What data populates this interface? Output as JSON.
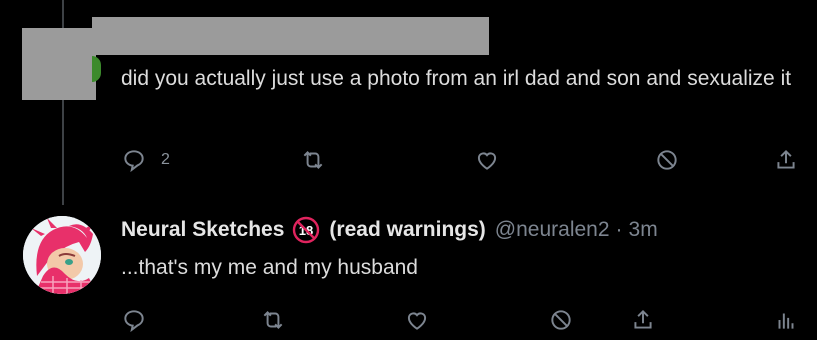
{
  "reply_tweet": {
    "text": "did you actually just use a photo from an irl dad and son and sexualize it",
    "reply_count": "2",
    "icons": [
      "reply-icon",
      "retweet-icon",
      "like-icon",
      "block-icon",
      "share-icon"
    ]
  },
  "response_tweet": {
    "display_name": "Neural Sketches",
    "badge_icon": "no-under-18-icon",
    "name_suffix": "(read warnings)",
    "handle": "@neuralen2",
    "separator": "·",
    "time": "3m",
    "text": "...that's my me and my husband",
    "icons": [
      "reply-icon",
      "retweet-icon",
      "like-icon",
      "block-icon",
      "share-icon",
      "analytics-icon"
    ]
  },
  "colors": {
    "background": "#000000",
    "text": "#dcdcdc",
    "muted": "#7d8590",
    "redaction": "#9b9b9b",
    "thread_line": "#3d4145",
    "badge_red": "#e0245e"
  }
}
